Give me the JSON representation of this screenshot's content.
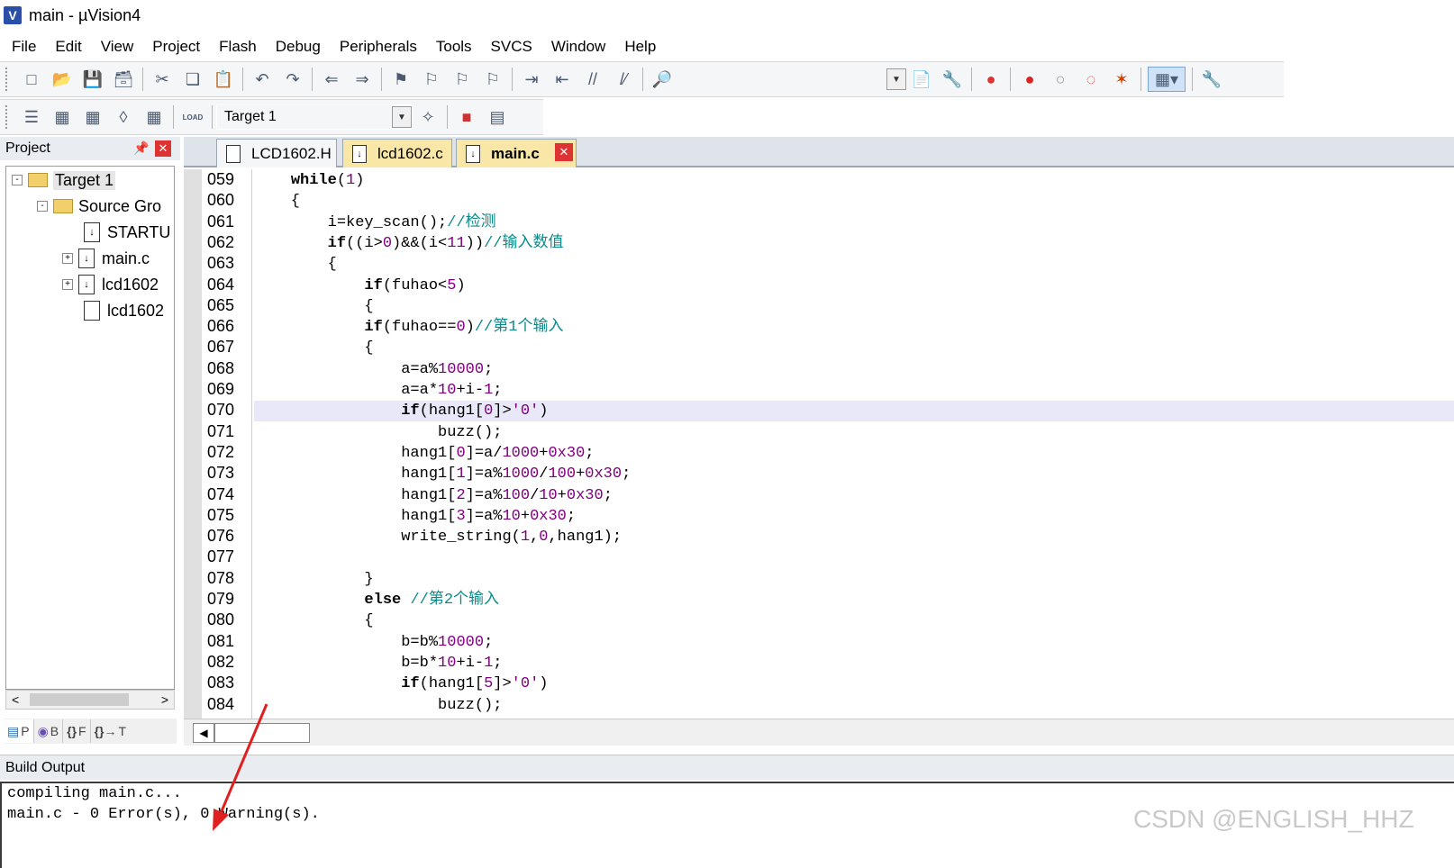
{
  "window": {
    "app_icon": "uvision-icon",
    "title": "main  - µVision4"
  },
  "menu": [
    "File",
    "Edit",
    "View",
    "Project",
    "Flash",
    "Debug",
    "Peripherals",
    "Tools",
    "SVCS",
    "Window",
    "Help"
  ],
  "toolbar2": {
    "load_label": "LOAD",
    "target": "Target 1"
  },
  "project_panel": {
    "title": "Project",
    "tree": [
      {
        "label": "Target 1",
        "type": "target",
        "expander": "-",
        "level": 0
      },
      {
        "label": "Source Gro",
        "type": "folder",
        "expander": "-",
        "level": 1
      },
      {
        "label": "STARTU",
        "type": "file",
        "expander": "",
        "level": 2
      },
      {
        "label": "main.c",
        "type": "file",
        "expander": "+",
        "level": 2
      },
      {
        "label": "lcd1602",
        "type": "file",
        "expander": "+",
        "level": 2
      },
      {
        "label": "lcd1602",
        "type": "file",
        "expander": "",
        "level": 2
      }
    ],
    "bottom_tabs": [
      "P",
      "B",
      "F",
      "T"
    ]
  },
  "editor": {
    "tabs": [
      "LCD1602.H",
      "lcd1602.c",
      "main.c"
    ],
    "active_tab": "main.c",
    "current_line": "070",
    "lines": [
      {
        "n": "059",
        "code": "    while(1)"
      },
      {
        "n": "060",
        "code": "    {"
      },
      {
        "n": "061",
        "code": "        i=key_scan();//检测"
      },
      {
        "n": "062",
        "code": "        if((i>0)&&(i<11))//输入数值"
      },
      {
        "n": "063",
        "code": "        {"
      },
      {
        "n": "064",
        "code": "            if(fuhao<5)"
      },
      {
        "n": "065",
        "code": "            {"
      },
      {
        "n": "066",
        "code": "            if(fuhao==0)//第1个输入"
      },
      {
        "n": "067",
        "code": "            {"
      },
      {
        "n": "068",
        "code": "                a=a%10000;"
      },
      {
        "n": "069",
        "code": "                a=a*10+i-1;"
      },
      {
        "n": "070",
        "code": "                if(hang1[0]>'0')"
      },
      {
        "n": "071",
        "code": "                    buzz();"
      },
      {
        "n": "072",
        "code": "                hang1[0]=a/1000+0x30;"
      },
      {
        "n": "073",
        "code": "                hang1[1]=a%1000/100+0x30;"
      },
      {
        "n": "074",
        "code": "                hang1[2]=a%100/10+0x30;"
      },
      {
        "n": "075",
        "code": "                hang1[3]=a%10+0x30;"
      },
      {
        "n": "076",
        "code": "                write_string(1,0,hang1);"
      },
      {
        "n": "077",
        "code": ""
      },
      {
        "n": "078",
        "code": "            }"
      },
      {
        "n": "079",
        "code": "            else //第2个输入"
      },
      {
        "n": "080",
        "code": "            {"
      },
      {
        "n": "081",
        "code": "                b=b%10000;"
      },
      {
        "n": "082",
        "code": "                b=b*10+i-1;"
      },
      {
        "n": "083",
        "code": "                if(hang1[5]>'0')"
      },
      {
        "n": "084",
        "code": "                    buzz();"
      }
    ]
  },
  "build_output": {
    "title": "Build Output",
    "lines": [
      "compiling main.c...",
      "main.c - 0 Error(s), 0 Warning(s)."
    ]
  },
  "watermark": "CSDN @ENGLISH_HHZ",
  "colors": {
    "keyword": "#000000",
    "number": "#800080",
    "comment": "#0a8a8a",
    "current_line": "#e8e8f8",
    "arrow": "#e02020"
  }
}
